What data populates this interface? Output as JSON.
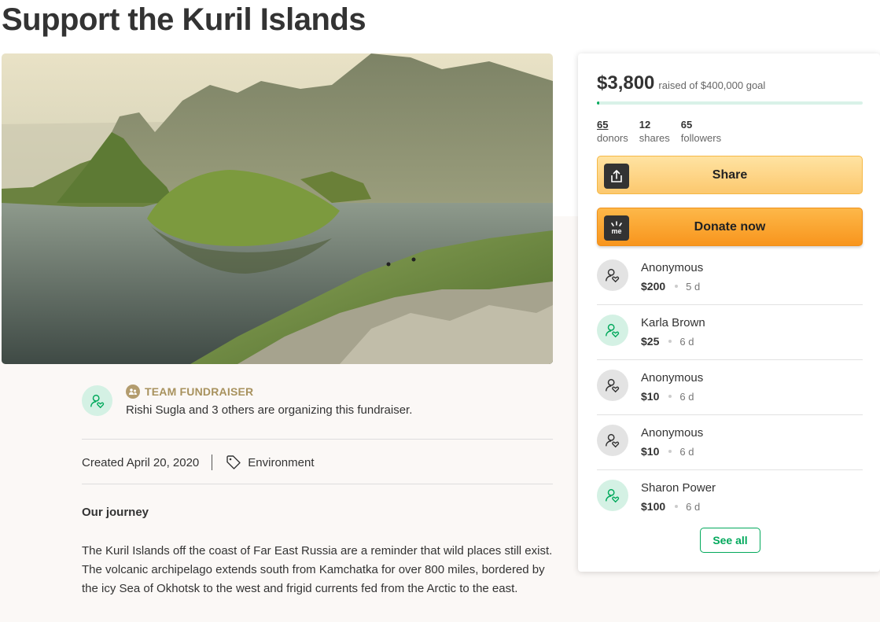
{
  "page": {
    "title": "Support the Kuril Islands"
  },
  "organizer": {
    "team_label": "TEAM FUNDRAISER",
    "text": "Rishi Sugla and 3 others are organizing this fundraiser."
  },
  "meta": {
    "created": "Created April 20, 2020",
    "category": "Environment"
  },
  "story": {
    "heading": "Our journey",
    "body": "The Kuril Islands off the coast of Far East Russia are a reminder that wild places still exist. The volcanic archipelago extends south from Kamchatka for over 800 miles, bordered by the icy Sea of Okhotsk to the west and frigid currents fed from the Arctic to the east."
  },
  "campaign": {
    "raised": "$3,800",
    "goal_text": "raised of $400,000 goal",
    "progress_fraction": 0.0095,
    "stats": [
      {
        "num": "65",
        "label": "donors"
      },
      {
        "num": "12",
        "label": "shares"
      },
      {
        "num": "65",
        "label": "followers"
      }
    ],
    "share_label": "Share",
    "donate_label": "Donate now",
    "see_all_label": "See all"
  },
  "donations": [
    {
      "name": "Anonymous",
      "amount": "$200",
      "time": "5 d",
      "avatar": "grey"
    },
    {
      "name": "Karla Brown",
      "amount": "$25",
      "time": "6 d",
      "avatar": "green"
    },
    {
      "name": "Anonymous",
      "amount": "$10",
      "time": "6 d",
      "avatar": "grey"
    },
    {
      "name": "Anonymous",
      "amount": "$10",
      "time": "6 d",
      "avatar": "grey"
    },
    {
      "name": "Sharon Power",
      "amount": "$100",
      "time": "6 d",
      "avatar": "green"
    }
  ],
  "colors": {
    "accent_green": "#02a95c",
    "donate_orange": "#f8951d",
    "share_yellow": "#fcc86e",
    "team_gold": "#a8925e"
  },
  "icons": {
    "share": "share-upload-icon",
    "donate": "gofundme-logo-icon",
    "team": "team-icon",
    "tag": "tag-icon",
    "avatar": "user-heart-icon"
  }
}
